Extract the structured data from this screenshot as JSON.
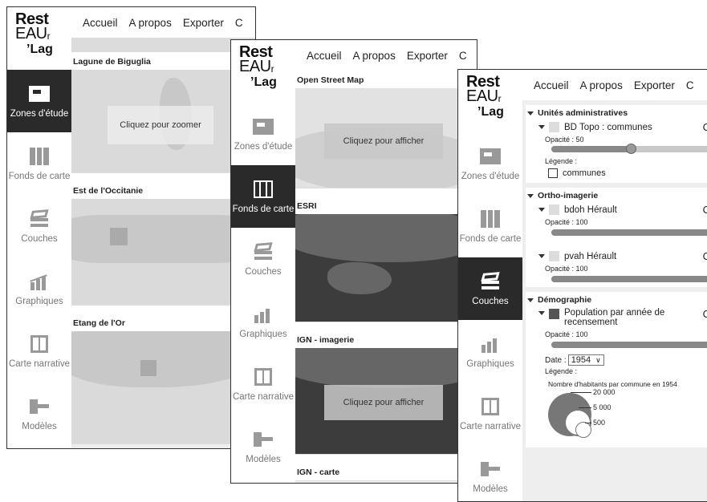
{
  "logo": {
    "line1": "Rest",
    "line2": "EAU",
    "line2_sub": "r",
    "line3": "’Lag"
  },
  "topnav": {
    "items": [
      "Accueil",
      "A propos",
      "Exporter",
      "C"
    ]
  },
  "sidenav": {
    "zones": "Zones d'étude",
    "fonds": "Fonds de carte",
    "couches": "Couches",
    "graphiques": "Graphiques",
    "carte": "Carte narrative",
    "modeles": "Modèles"
  },
  "w1": {
    "cards": [
      {
        "title": "Lagune de Biguglia",
        "overlay": "Cliquez pour zoomer"
      },
      {
        "title": "Est de l'Occitanie",
        "overlay": ""
      },
      {
        "title": "Etang de l'Or",
        "overlay": ""
      }
    ]
  },
  "w2": {
    "cards": [
      {
        "title": "Open Street Map",
        "overlay": "Cliquez pour afficher"
      },
      {
        "title": "ESRI",
        "overlay": ""
      },
      {
        "title": "IGN - imagerie",
        "overlay": "Cliquez pour afficher"
      },
      {
        "title": "IGN - carte",
        "overlay": ""
      }
    ]
  },
  "w3": {
    "group1": {
      "title": "Unités administratives",
      "layer": "BD Topo : communes",
      "opacity": "Opacité : 50",
      "opacity_value": 50,
      "legend": "Légende :",
      "legend_item": "communes",
      "toggle": "C"
    },
    "group2": {
      "title": "Ortho-imagerie",
      "layer1": "bdoh Hérault",
      "opacity1": "Opacité : 100",
      "opacity1_value": 100,
      "layer2": "pvah Hérault",
      "opacity2": "Opacité : 100",
      "opacity2_value": 100,
      "toggle": "C"
    },
    "group3": {
      "title": "Démographie",
      "layer": "Population par année de recensement",
      "opacity": "Opacité : 100",
      "opacity_value": 100,
      "date_label": "Date :",
      "date_value": "1954",
      "legend": "Légende :",
      "legend_title": "Nombre d'habitants par commune en 1954",
      "legend_values": [
        "20 000",
        "5 000",
        "500"
      ],
      "toggle": "C"
    }
  },
  "colors": {
    "active_nav": "#2a2a2a",
    "slider_fill": "#888888",
    "panel_bg": "#eeeeee"
  }
}
